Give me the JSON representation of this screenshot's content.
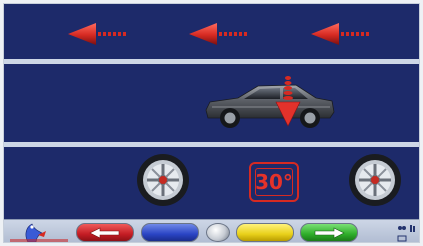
{
  "angle_display": {
    "value": "30°"
  },
  "direction_arrows": {
    "count": 3,
    "direction": "left",
    "icon": "red-arrow-left-icon"
  },
  "function_keys": [
    {
      "color": "#d12a2a",
      "icon": "arrow-left-icon"
    },
    {
      "color": "#2e47c6",
      "icon": ""
    },
    {
      "color": "#c7ccd4",
      "icon": ""
    },
    {
      "color": "#e8d01a",
      "icon": ""
    },
    {
      "color": "#2fae2a",
      "icon": "arrow-right-icon"
    }
  ],
  "colors": {
    "panel": "#1d2a6a",
    "rule": "#cdd6e6",
    "arrow": "#d62a22",
    "angle": "#e5322a"
  }
}
